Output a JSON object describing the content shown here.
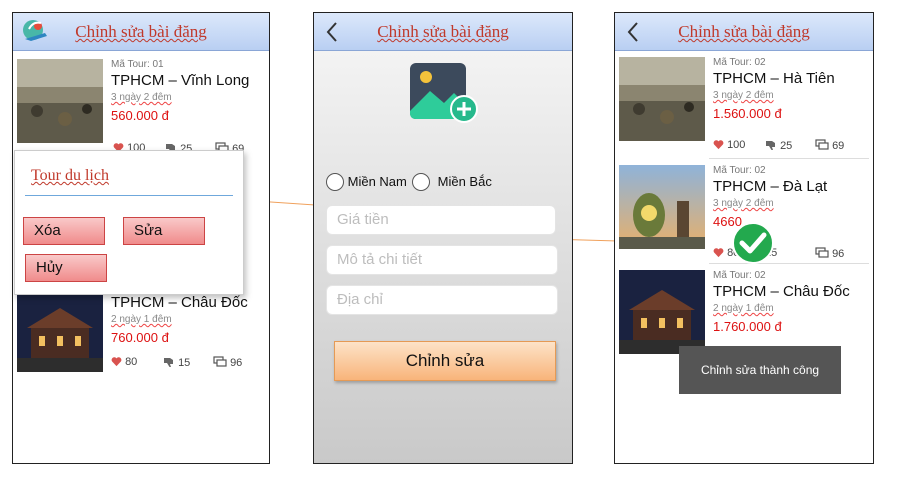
{
  "screen1": {
    "title": "Chỉnh sửa bài đăng",
    "logo_icon": "travel-globe-plane-icon",
    "cards": [
      {
        "code": "Mã Tour: 01",
        "route": "TPHCM – Vĩnh Long",
        "days": "3 ngày 2 đêm",
        "price": "560.000 đ",
        "likes": "100",
        "dislikes": "25",
        "comments": "69"
      },
      {
        "code": "Mã Tour: 02",
        "route": "TPHCM – Châu Đốc",
        "days": "2 ngày 1 đêm",
        "price": "760.000 đ",
        "likes": "80",
        "dislikes": "15",
        "comments": "96"
      }
    ],
    "dialog": {
      "title": "Tour du lịch",
      "delete_label": "Xóa",
      "edit_label": "Sửa",
      "cancel_label": "Hủy"
    }
  },
  "screen2": {
    "title": "Chỉnh sửa bài đăng",
    "image_icon": "add-image-icon",
    "radio_south": "Miền Nam",
    "radio_north": "Miền Bắc",
    "price_placeholder": "Giá tiền",
    "description_placeholder": "Mô tả chi tiết",
    "address_placeholder": "Địa chỉ",
    "submit_label": "Chỉnh sửa"
  },
  "screen3": {
    "title": "Chỉnh sửa bài đăng",
    "cards": [
      {
        "code": "Mã Tour: 02",
        "route": "TPHCM – Hà Tiên",
        "days": "3 ngày 2 đêm",
        "price": "1.560.000 đ",
        "likes": "100",
        "dislikes": "25",
        "comments": "69"
      },
      {
        "code": "Mã Tour: 02",
        "route": "TPHCM – Đà Lạt",
        "days": "3 ngày 2 đêm",
        "price": "4660",
        "likes": "80",
        "dislikes": "15",
        "comments": "96"
      },
      {
        "code": "Mã Tour: 02",
        "route": "TPHCM – Châu Đốc",
        "days": "2 ngày 1 đêm",
        "price": "1.760.000 đ",
        "likes": "",
        "dislikes": "",
        "comments": ""
      }
    ],
    "toast": "Chỉnh sửa thành công",
    "success_icon": "check-circle-icon"
  },
  "colors": {
    "accent_red": "#d11111",
    "header_blue": "#c9dbf7",
    "button_orange": "#f9c08a"
  }
}
